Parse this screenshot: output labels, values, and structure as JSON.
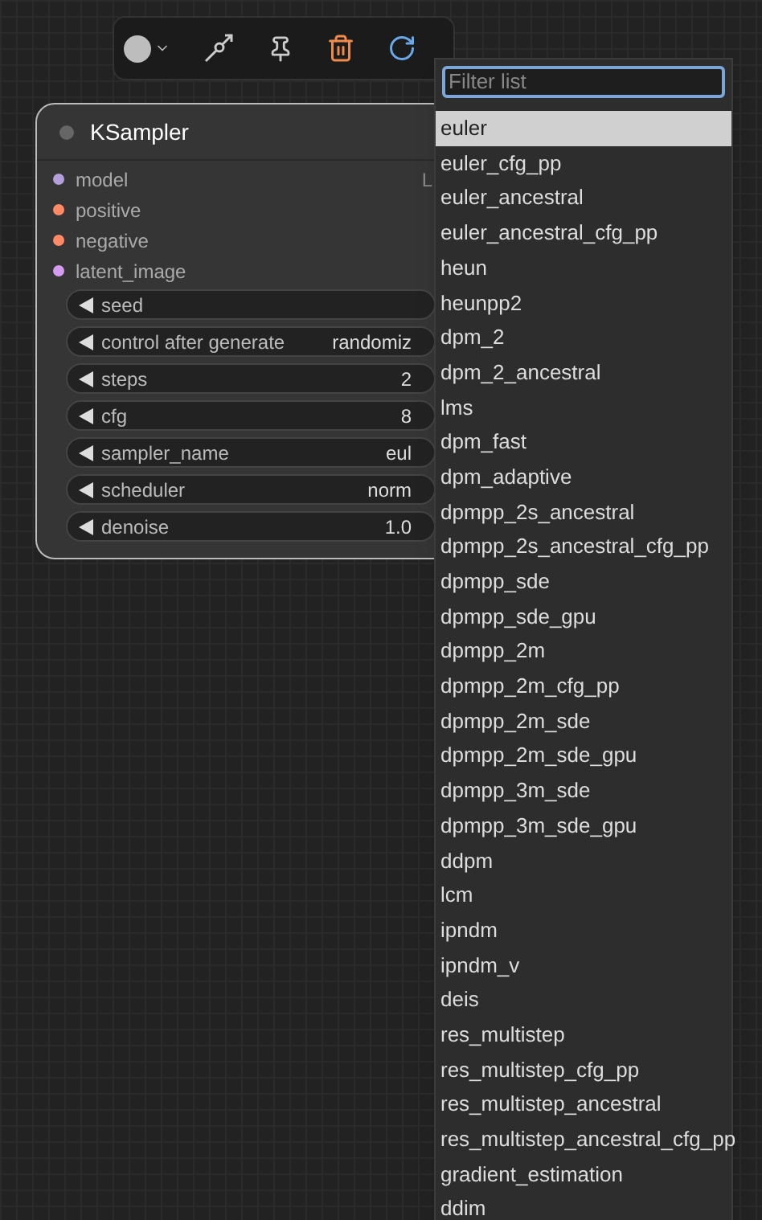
{
  "node": {
    "title": "KSampler",
    "inputs": [
      {
        "label": "model",
        "color": "#b39ddb",
        "output": "L"
      },
      {
        "label": "positive",
        "color": "#ff8a65"
      },
      {
        "label": "negative",
        "color": "#ff8a65"
      },
      {
        "label": "latent_image",
        "color": "#d49cf0"
      }
    ],
    "widgets": [
      {
        "label": "seed"
      },
      {
        "label": "control after generate",
        "value": "randomiz"
      },
      {
        "label": "steps",
        "value": "2"
      },
      {
        "label": "cfg",
        "value": "8"
      },
      {
        "label": "sampler_name",
        "value": "eul"
      },
      {
        "label": "scheduler",
        "value": "norm"
      },
      {
        "label": "denoise",
        "value": "1.0"
      }
    ]
  },
  "dropdown": {
    "placeholder": "Filter list",
    "items": [
      {
        "label": "euler",
        "selected": true
      },
      {
        "label": "euler_cfg_pp",
        "selected": false
      },
      {
        "label": "euler_ancestral",
        "selected": false
      },
      {
        "label": "euler_ancestral_cfg_pp",
        "selected": false
      },
      {
        "label": "heun",
        "selected": false
      },
      {
        "label": "heunpp2",
        "selected": false
      },
      {
        "label": "dpm_2",
        "selected": false
      },
      {
        "label": "dpm_2_ancestral",
        "selected": false
      },
      {
        "label": "lms",
        "selected": false
      },
      {
        "label": "dpm_fast",
        "selected": false
      },
      {
        "label": "dpm_adaptive",
        "selected": false
      },
      {
        "label": "dpmpp_2s_ancestral",
        "selected": false
      },
      {
        "label": "dpmpp_2s_ancestral_cfg_pp",
        "selected": false
      },
      {
        "label": "dpmpp_sde",
        "selected": false
      },
      {
        "label": "dpmpp_sde_gpu",
        "selected": false
      },
      {
        "label": "dpmpp_2m",
        "selected": false
      },
      {
        "label": "dpmpp_2m_cfg_pp",
        "selected": false
      },
      {
        "label": "dpmpp_2m_sde",
        "selected": false
      },
      {
        "label": "dpmpp_2m_sde_gpu",
        "selected": false
      },
      {
        "label": "dpmpp_3m_sde",
        "selected": false
      },
      {
        "label": "dpmpp_3m_sde_gpu",
        "selected": false
      },
      {
        "label": "ddpm",
        "selected": false
      },
      {
        "label": "lcm",
        "selected": false
      },
      {
        "label": "ipndm",
        "selected": false
      },
      {
        "label": "ipndm_v",
        "selected": false
      },
      {
        "label": "deis",
        "selected": false
      },
      {
        "label": "res_multistep",
        "selected": false
      },
      {
        "label": "res_multistep_cfg_pp",
        "selected": false
      },
      {
        "label": "res_multistep_ancestral",
        "selected": false
      },
      {
        "label": "res_multistep_ancestral_cfg_pp",
        "selected": false
      },
      {
        "label": "gradient_estimation",
        "selected": false
      },
      {
        "label": "ddim",
        "selected": false
      }
    ]
  }
}
